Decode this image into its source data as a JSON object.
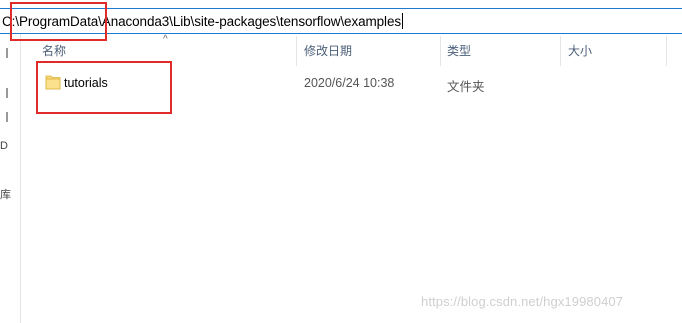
{
  "address_bar": {
    "path": "C:\\ProgramData\\Anaconda3\\Lib\\site-packages\\tensorflow\\examples"
  },
  "left_pane": {
    "fragments": [
      "D",
      "库"
    ]
  },
  "columns": [
    {
      "label": "名称"
    },
    {
      "label": "修改日期"
    },
    {
      "label": "类型"
    },
    {
      "label": "大小"
    }
  ],
  "sort_indicator": "^",
  "files": [
    {
      "name": "tutorials",
      "modified": "2020/6/24 10:38",
      "type": "文件夹",
      "size": "",
      "icon": "folder-icon"
    }
  ],
  "annotation_color": "#e02b2b",
  "watermark": "https://blog.csdn.net/hgx19980407"
}
